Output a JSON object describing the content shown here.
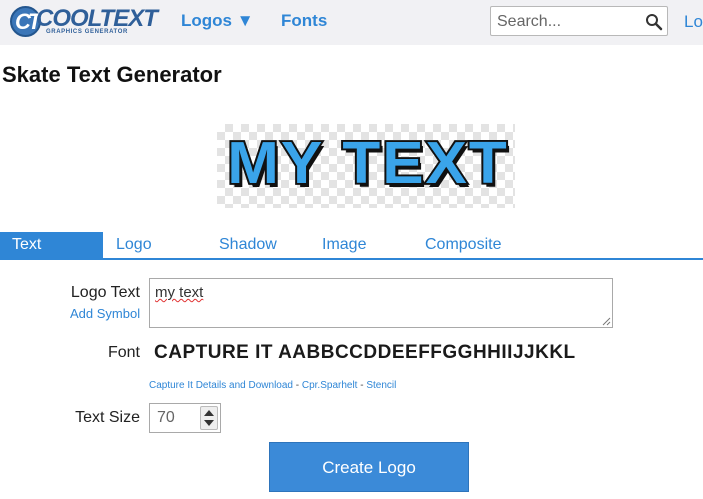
{
  "header": {
    "brand": "COOLTEXT",
    "brand_tagline": "GRAPHICS GENERATOR",
    "nav_logos": "Logos ▼",
    "nav_fonts": "Fonts",
    "search_placeholder": "Search...",
    "nav_login": "Lo"
  },
  "page_title": "Skate Text Generator",
  "preview": {
    "text": "MY TEXT",
    "fill_color": "#3aa4ea",
    "outline_color": "#111111"
  },
  "tabs": [
    "Text",
    "Logo",
    "Shadow",
    "Image",
    "Composite"
  ],
  "active_tab": "Text",
  "form": {
    "logo_text_label": "Logo Text",
    "add_symbol_label": "Add Symbol",
    "logo_text_value": "my text",
    "font_label": "Font",
    "font_sample": "CAPTURE IT AABBCCDDEEFFGGHHIIJJKKL",
    "font_links": [
      "Capture It Details and Download",
      "Cpr.Sparhelt",
      "Stencil"
    ],
    "font_link_separator": " - ",
    "text_size_label": "Text Size",
    "text_size_value": "70",
    "create_button": "Create Logo"
  },
  "colors": {
    "accent": "#2f86d6",
    "brand": "#2f5f99",
    "button": "#3b8ad8"
  }
}
